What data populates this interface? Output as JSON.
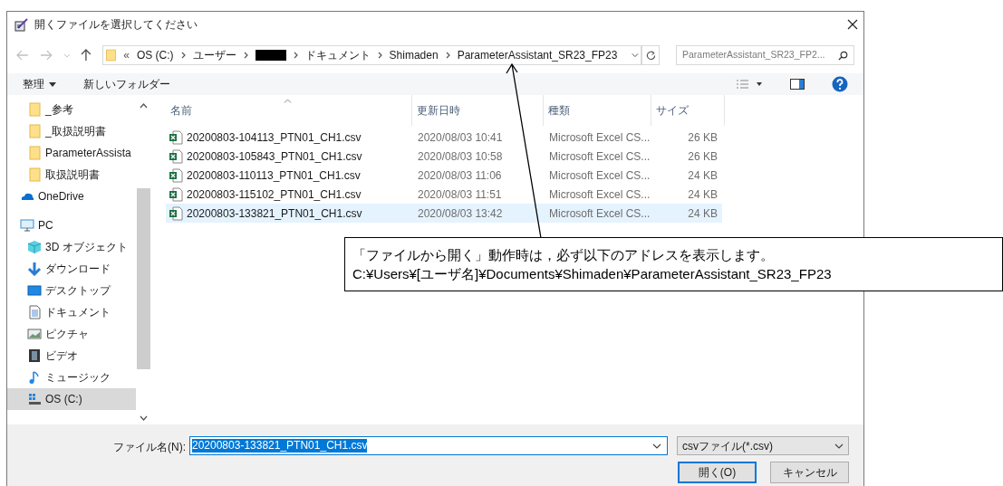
{
  "window": {
    "title": "開くファイルを選択してください"
  },
  "address_bar": {
    "overflow": "«",
    "crumbs": [
      {
        "kind": "text",
        "label": "OS (C:)"
      },
      {
        "kind": "text",
        "label": "ユーザー"
      },
      {
        "kind": "redacted"
      },
      {
        "kind": "text",
        "label": "ドキュメント"
      },
      {
        "kind": "text",
        "label": "Shimaden"
      },
      {
        "kind": "text",
        "label": "ParameterAssistant_SR23_FP23"
      }
    ]
  },
  "search": {
    "placeholder": "ParameterAssistant_SR23_FP2..."
  },
  "toolbar": {
    "organize": "整理",
    "new_folder": "新しいフォルダー"
  },
  "sidebar": {
    "items": [
      {
        "children": [
          {
            "label": "_参考",
            "kind": "folder",
            "selected": false
          },
          {
            "label": "_取扱説明書",
            "kind": "folder",
            "selected": false
          },
          {
            "label": "ParameterAssista",
            "kind": "folder",
            "selected": false
          },
          {
            "label": "取扱説明書",
            "kind": "folder",
            "selected": false
          }
        ]
      },
      {
        "label": "OneDrive",
        "kind": "cloud",
        "selected": false
      },
      {
        "label": "PC",
        "kind": "pc",
        "selected": false,
        "children": [
          {
            "label": "3D オブジェクト",
            "kind": "cube",
            "selected": false
          },
          {
            "label": "ダウンロード",
            "kind": "download",
            "selected": false
          },
          {
            "label": "デスクトップ",
            "kind": "desktop",
            "selected": false
          },
          {
            "label": "ドキュメント",
            "kind": "document",
            "selected": false
          },
          {
            "label": "ピクチャ",
            "kind": "picture",
            "selected": false
          },
          {
            "label": "ビデオ",
            "kind": "video",
            "selected": false
          },
          {
            "label": "ミュージック",
            "kind": "music",
            "selected": false
          },
          {
            "label": "OS (C:)",
            "kind": "drive",
            "selected": true
          }
        ]
      }
    ]
  },
  "table": {
    "columns": [
      "名前",
      "更新日時",
      "種類",
      "サイズ"
    ],
    "rows": [
      {
        "name": "20200803-104113_PTN01_CH1.csv",
        "modified": "2020/08/03 10:41",
        "type": "Microsoft Excel CS...",
        "size": "26 KB",
        "selected": false
      },
      {
        "name": "20200803-105843_PTN01_CH1.csv",
        "modified": "2020/08/03 10:58",
        "type": "Microsoft Excel CS...",
        "size": "26 KB",
        "selected": false
      },
      {
        "name": "20200803-110113_PTN01_CH1.csv",
        "modified": "2020/08/03 11:06",
        "type": "Microsoft Excel CS...",
        "size": "24 KB",
        "selected": false
      },
      {
        "name": "20200803-115102_PTN01_CH1.csv",
        "modified": "2020/08/03 11:51",
        "type": "Microsoft Excel CS...",
        "size": "24 KB",
        "selected": false
      },
      {
        "name": "20200803-133821_PTN01_CH1.csv",
        "modified": "2020/08/03 13:42",
        "type": "Microsoft Excel CS...",
        "size": "24 KB",
        "selected": true
      }
    ]
  },
  "footer": {
    "filename_label": "ファイル名(N):",
    "filename_value": "20200803-133821_PTN01_CH1.csv",
    "filter": "csvファイル(*.csv)",
    "open_button": "開く(O)",
    "cancel_button": "キャンセル"
  },
  "callout": {
    "lines": [
      "「ファイルから開く」動作時は，必ず以下のアドレスを表示します。",
      "C:¥Users¥[ユーザ名]¥Documents¥Shimaden¥ParameterAssistant_SR23_FP23"
    ]
  }
}
